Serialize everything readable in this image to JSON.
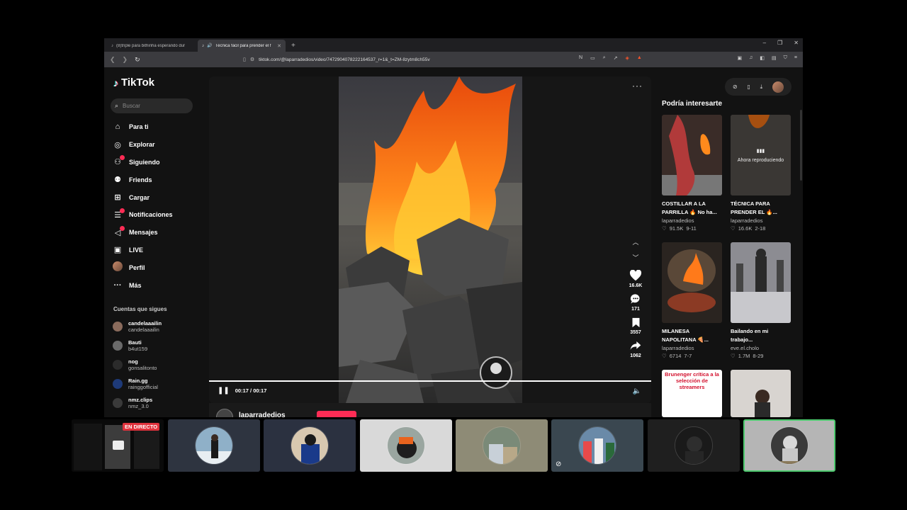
{
  "browser": {
    "tabs": [
      {
        "title": "(8)triple para bithinha esperando dur",
        "active": false
      },
      {
        "title": "Técnica fácil para prender el f",
        "active": true
      }
    ],
    "new_tab": "+",
    "url": "tiktok.com/@laparradedios/video/7472904078222164537_r=1&_t=ZM-8zytm8ch55v"
  },
  "tiktok": {
    "logo": "TikTok",
    "search_placeholder": "Buscar",
    "nav": [
      {
        "label": "Para ti",
        "icon": "home-icon",
        "badge": false
      },
      {
        "label": "Explorar",
        "icon": "compass-icon",
        "badge": false
      },
      {
        "label": "Siguiendo",
        "icon": "following-icon",
        "badge": true
      },
      {
        "label": "Friends",
        "icon": "friends-icon",
        "badge": false
      },
      {
        "label": "Cargar",
        "icon": "upload-icon",
        "badge": false
      },
      {
        "label": "Notificaciones",
        "icon": "notifications-icon",
        "badge": true
      },
      {
        "label": "Mensajes",
        "icon": "messages-icon",
        "badge": true
      },
      {
        "label": "LIVE",
        "icon": "live-icon",
        "badge": false
      },
      {
        "label": "Perfil",
        "icon": "profile-avatar-icon",
        "badge": false
      },
      {
        "label": "Más",
        "icon": "more-icon",
        "badge": false
      }
    ],
    "following_title": "Cuentas que sigues",
    "following": [
      {
        "name": "candelaaailin",
        "user": "candelaaailin",
        "color": "#8a6b5c"
      },
      {
        "name": "Bauti",
        "user": "b4ut159",
        "color": "#6a6a6a"
      },
      {
        "name": "nog",
        "user": "gonsalitonto",
        "color": "#2b2b2b"
      },
      {
        "name": "Rain.gg",
        "user": "rainggofficial",
        "color": "#1e3a78"
      },
      {
        "name": "nmz.clips",
        "user": "nmz_3.0",
        "color": "#3a3a3a"
      }
    ],
    "video": {
      "time": "00:17 / 00:17",
      "progress": 1.0,
      "likes": "16.6K",
      "comments": "171",
      "saves": "3557",
      "shares": "1062",
      "author": "laparradedios"
    },
    "recommended_title": "Podría interesarte",
    "recommended": [
      {
        "caption": "COSTILLAR A LA PARRILLA 🔥 No ha...",
        "author": "laparradedios",
        "likes": "91.5K",
        "date": "9-11",
        "now_playing": false
      },
      {
        "caption": "TÉCNICA PARA PRENDER EL 🔥...",
        "author": "laparradedios",
        "likes": "16.6K",
        "date": "2-18",
        "now_playing": true
      },
      {
        "caption": "MILANESA NAPOLITANA 🍕...",
        "author": "laparradedios",
        "likes": "6714",
        "date": "7-7",
        "now_playing": false
      },
      {
        "caption": "Bailando en mi trabajo...",
        "author": "eve.el.cholo",
        "likes": "1.7M",
        "date": "8-29",
        "now_playing": false
      }
    ],
    "now_playing_label": "Ahora reproduciendo",
    "thumb_text": "Brunenger crítica a la selección de streamers"
  },
  "meeting": {
    "live_label": "EN DIRECTO",
    "participants": [
      {
        "bg": "#2e3440"
      },
      {
        "bg": "#2b3140"
      },
      {
        "bg": "#d9d9d9"
      },
      {
        "bg": "#8e8b76"
      },
      {
        "bg": "#3a4750"
      },
      {
        "bg": "#1f1f1f"
      },
      {
        "bg": "#b5b5b5"
      }
    ]
  },
  "colors": {
    "accent": "#fe2c55",
    "live": "#e0323c",
    "speaking": "#4ecb6f"
  }
}
